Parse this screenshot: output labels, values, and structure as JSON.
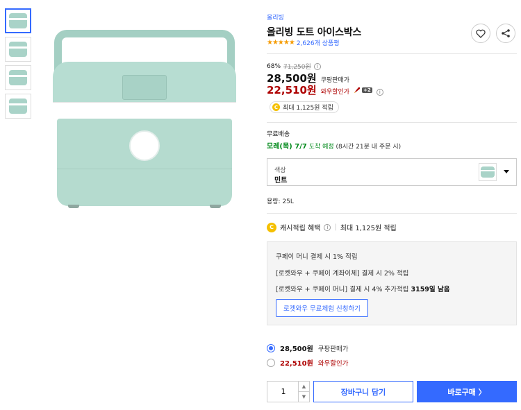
{
  "product": {
    "brand": "올리빙",
    "title": "올리빙 도트 아이스박스",
    "rating_stars": "★★★★★",
    "review_count": "2,626개 상품평",
    "thumbnails": [
      "thumb-1",
      "thumb-2",
      "thumb-3",
      "thumb-4"
    ]
  },
  "actions": {
    "wishlist_icon": "heart-icon",
    "share_icon": "share-icon"
  },
  "pricing": {
    "discount_rate": "68%",
    "original_price": "71,250원",
    "price": "28,500원",
    "price_label": "쿠팡판매가",
    "member_price": "22,510원",
    "member_label": "와우할인가",
    "rocket_badge": "+2",
    "reward_text": "최대 1,125원 적립",
    "coin_glyph": "C",
    "accent_color": "#346aff",
    "sale_color": "#ae0000"
  },
  "shipping": {
    "label": "무료배송",
    "date_strong": "모레(목) 7/7",
    "date_suffix": "도착 예정",
    "note": "(8시간 21분 내 주문 시)"
  },
  "option": {
    "label": "색상",
    "value": "민트",
    "capacity": "용량: 25L"
  },
  "cash": {
    "label": "캐시적립 혜택",
    "max_reward": "최대 1,125원 적립"
  },
  "benefits": {
    "line1": "쿠페이 머니 결제 시 1% 적립",
    "line2": "[로켓와우 + 쿠페이 계좌이체] 결제 시 2% 적립",
    "line3_prefix": "[로켓와우 + 쿠페이 머니] 결제 시 4% 추가적립",
    "line3_strong": "3159일 남음",
    "trial_button": "로켓와우 무료체험 신청하기"
  },
  "price_options": [
    {
      "amount": "28,500원",
      "label": "쿠팡판매가",
      "selected": true
    },
    {
      "amount": "22,510원",
      "label": "와우할인가",
      "selected": false
    }
  ],
  "purchase": {
    "quantity": "1",
    "cart_button": "장바구니 담기",
    "buy_button": "바로구매 〉"
  }
}
